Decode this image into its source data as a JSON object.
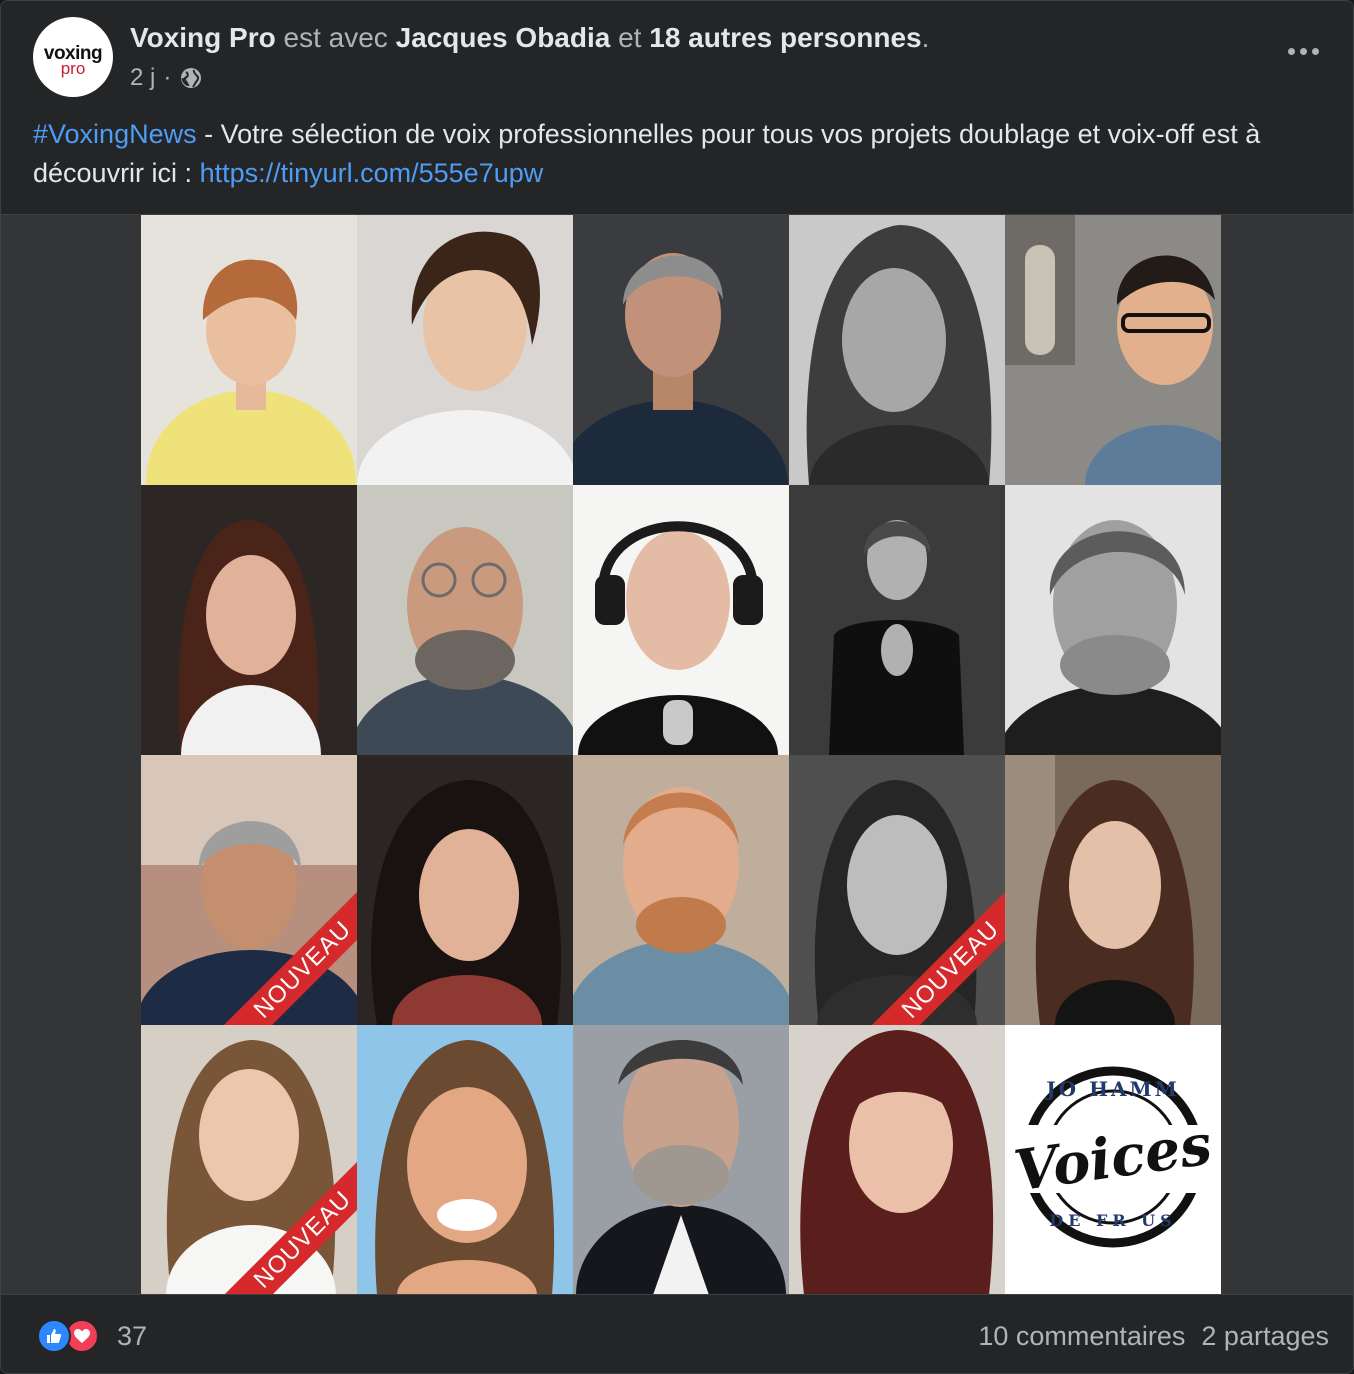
{
  "post": {
    "author": "Voxing Pro",
    "with_text": "est avec",
    "tagged": "Jacques Obadia",
    "and_text": "et",
    "others": "18 autres personnes",
    "period": ".",
    "time": "2 j",
    "separator": "·",
    "privacy_icon": "globe-icon",
    "avatar_logo_top": "voxing",
    "avatar_logo_bottom": "pro",
    "hashtag": "#VoxingNews",
    "body_text": " - Votre sélection de voix professionnelles pour tous vos projets doublage et voix-off est à découvrir ici : ",
    "link": "https://tinyurl.com/555e7upw"
  },
  "photos": {
    "ribbon_label": "NOUVEAU",
    "logo_arc_top": "JO HAMM",
    "logo_word": "Voices",
    "logo_arc_bottom": "DE FR US"
  },
  "footer": {
    "reaction_icons": [
      "like-icon",
      "love-icon"
    ],
    "reaction_count": "37",
    "comments": "10 commentaires",
    "shares": "2 partages"
  },
  "colors": {
    "background": "#242526",
    "link": "#4e9cf5",
    "ribbon": "#d5292c",
    "like": "#2d88ff",
    "love": "#f33e58"
  }
}
